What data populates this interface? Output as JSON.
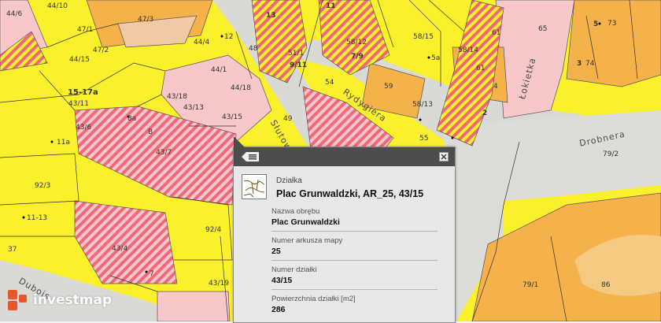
{
  "map": {
    "parcel_labels": [
      "44/6",
      "44/10",
      "47/3",
      "47/1",
      "47/2",
      "44/4",
      "12",
      "44/15",
      "15-17a",
      "43/11",
      "44/1",
      "44/18",
      "43/18",
      "43/13",
      "43/15",
      "8a",
      "B",
      "43/6",
      "43/7",
      "11a",
      "92/3",
      "11-13",
      "92/4",
      "37",
      "43/4",
      "43/19",
      "7",
      "13",
      "11",
      "48",
      "51/1",
      "9/11",
      "58/12",
      "7/9",
      "54",
      "5a",
      "58/15",
      "59",
      "58/14",
      "58/13",
      "65",
      "5",
      "73",
      "3",
      "74",
      "61",
      "61",
      "2",
      "4",
      "55",
      "49",
      "79/2",
      "79/1",
      "86"
    ],
    "street_names": [
      "Słutowa",
      "Rydygiera",
      "Łokietka",
      "Drobnera",
      "Dubois"
    ]
  },
  "popup": {
    "header_label": "Działka",
    "title": "Plac Grunwaldzki, AR_25, 43/15",
    "fields": [
      {
        "label": "Nazwa obrębu",
        "value": "Plac Grunwaldzki"
      },
      {
        "label": "Numer arkusza mapy",
        "value": "25"
      },
      {
        "label": "Numer działki",
        "value": "43/15"
      },
      {
        "label": "Powierzchnia działki [m2]",
        "value": "286"
      }
    ]
  },
  "logo": {
    "text": "investmap"
  },
  "colors": {
    "yellow": "#fbf02c",
    "orange": "#f6b24a",
    "pink": "#f7c7c9",
    "hatch_red": "#f2677a",
    "road": "#d9d9d5"
  }
}
